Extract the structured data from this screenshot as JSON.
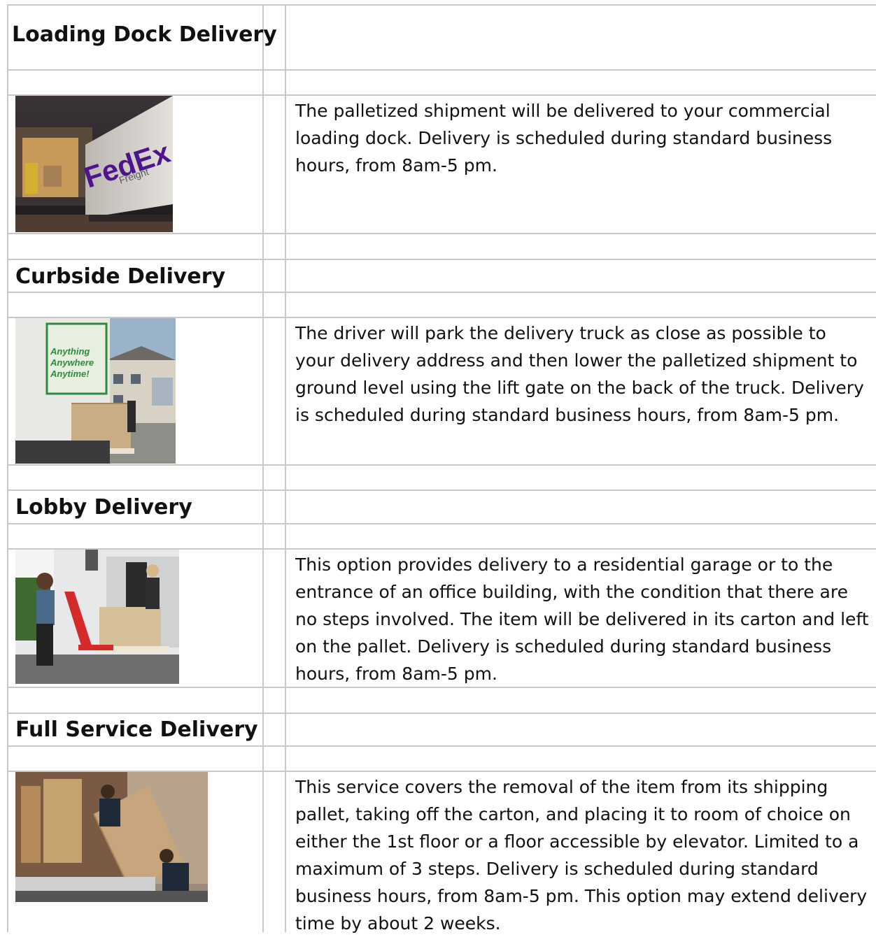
{
  "sections": [
    {
      "heading": "Loading Dock Delivery",
      "description": "The palletized shipment will be delivered to your commercial loading dock. Delivery is scheduled during standard business hours, from 8am-5 pm.",
      "photo": {
        "truck_brand_line1": "FedEx",
        "truck_brand_line2": "Freight"
      }
    },
    {
      "heading": "Curbside Delivery",
      "description": "The driver will park the delivery truck as close as possible to your delivery address and then lower the palletized shipment to ground level using the lift gate on the back of the truck. Delivery is scheduled during standard business hours, from 8am-5 pm.",
      "photo": {
        "truck_banner": [
          "Anything",
          "Anywhere",
          "Anytime!"
        ]
      }
    },
    {
      "heading": "Lobby Delivery",
      "description": "This option provides delivery to a residential garage or to the entrance of an office building, with the condition that there are no steps involved. The item will be delivered in its carton and left on the pallet. Delivery is scheduled during standard business hours, from 8am-5 pm."
    },
    {
      "heading": "Full Service Delivery",
      "description": "This service covers the removal of the item from its shipping pallet, taking off the carton, and placing it to room of choice on either the 1st floor or a floor accessible by elevator. Limited to a maximum of 3 steps. Delivery is scheduled during standard business hours, from 8am-5 pm. This option may extend delivery time by about 2 weeks."
    }
  ],
  "colors": {
    "grid_line": "#c8c8c8",
    "text": "#111111",
    "fedex_purple": "#4d148c",
    "fedex_orange": "#ff6200",
    "rl_green": "#2e8b3d",
    "pallet_jack_red": "#d42a2a"
  }
}
